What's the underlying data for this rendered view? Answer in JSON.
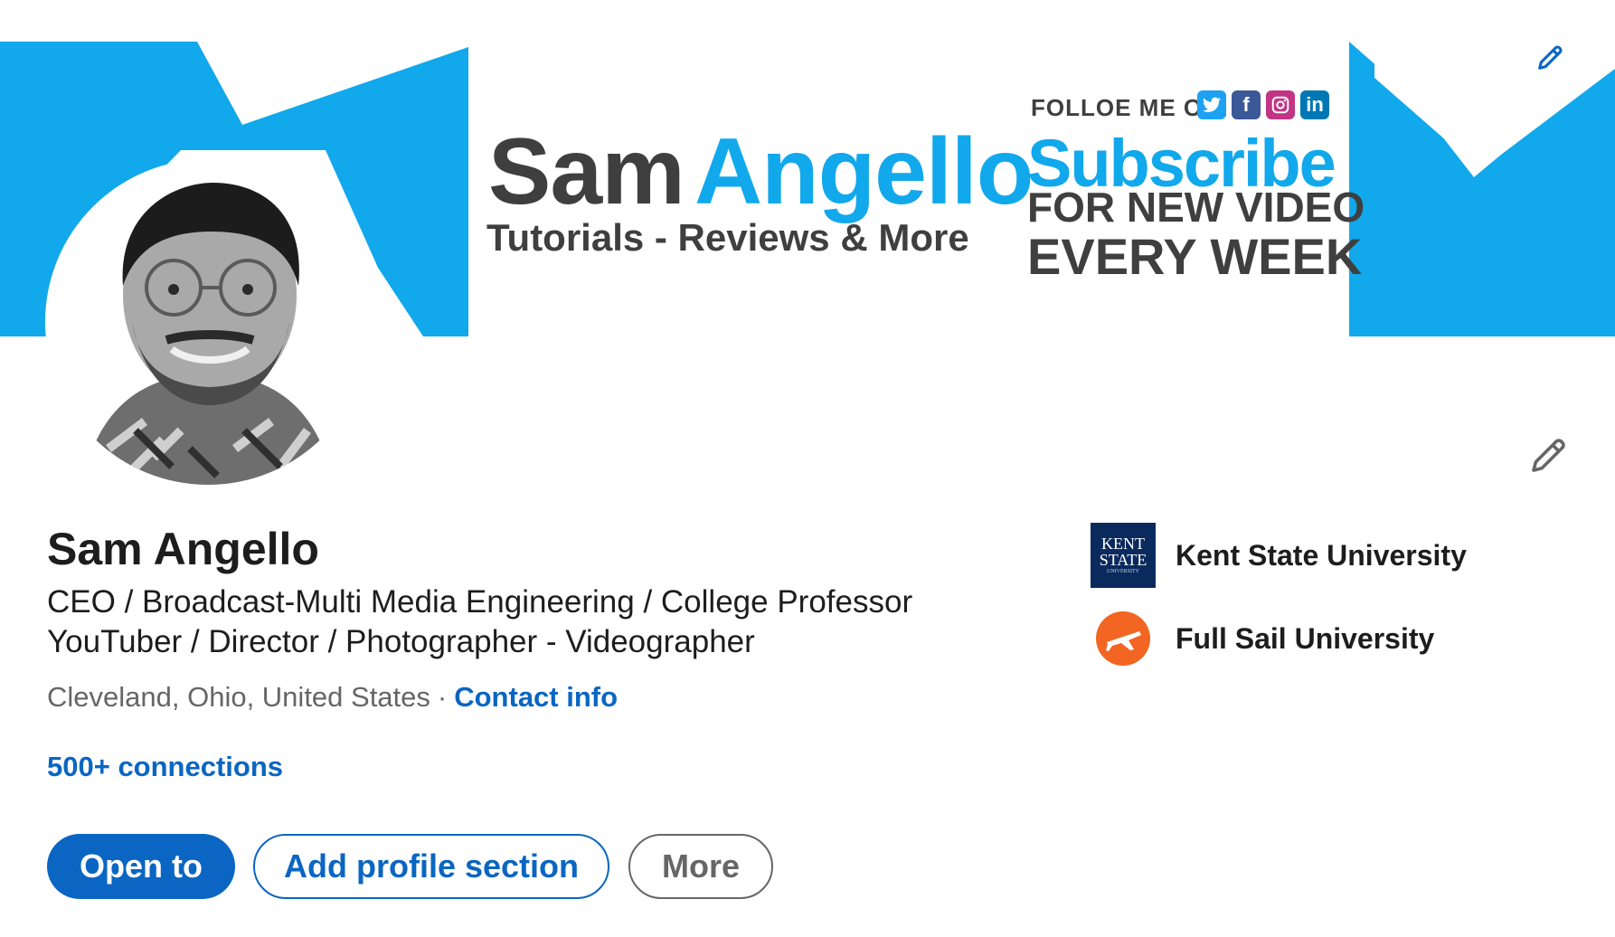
{
  "banner": {
    "first_name": "Sam",
    "last_name": "Angello",
    "tagline": "Tutorials - Reviews & More",
    "follow_text": "FOLLOE ME ON:",
    "subscribe": "Subscribe",
    "new_video": "FOR NEW VIDEO",
    "every_week": "EVERY WEEK",
    "accent_color": "#11a8ec",
    "social_icons": [
      "twitter-icon",
      "facebook-icon",
      "instagram-icon",
      "linkedin-icon"
    ],
    "social_labels": {
      "facebook": "f",
      "linkedin": "in"
    }
  },
  "profile": {
    "name": "Sam Angello",
    "headline_line1": "CEO / Broadcast-Multi Media Engineering / College Professor",
    "headline_line2": "YouTuber / Director / Photographer - Videographer",
    "location": "Cleveland, Ohio, United States",
    "separator": "·",
    "contact_info": "Contact info",
    "connections": "500+ connections"
  },
  "actions": {
    "open_to": "Open to",
    "add_section": "Add profile section",
    "more": "More"
  },
  "education": [
    {
      "name": "Kent State University",
      "logo_text_1": "KENT",
      "logo_text_2": "STATE",
      "logo_text_3": "UNIVERSITY",
      "logo_color": "#0a2a5e"
    },
    {
      "name": "Full Sail University",
      "logo_color": "#f26522"
    }
  ],
  "colors": {
    "primary": "#0a66c2",
    "text": "#1d1d1d",
    "muted": "#666666"
  }
}
